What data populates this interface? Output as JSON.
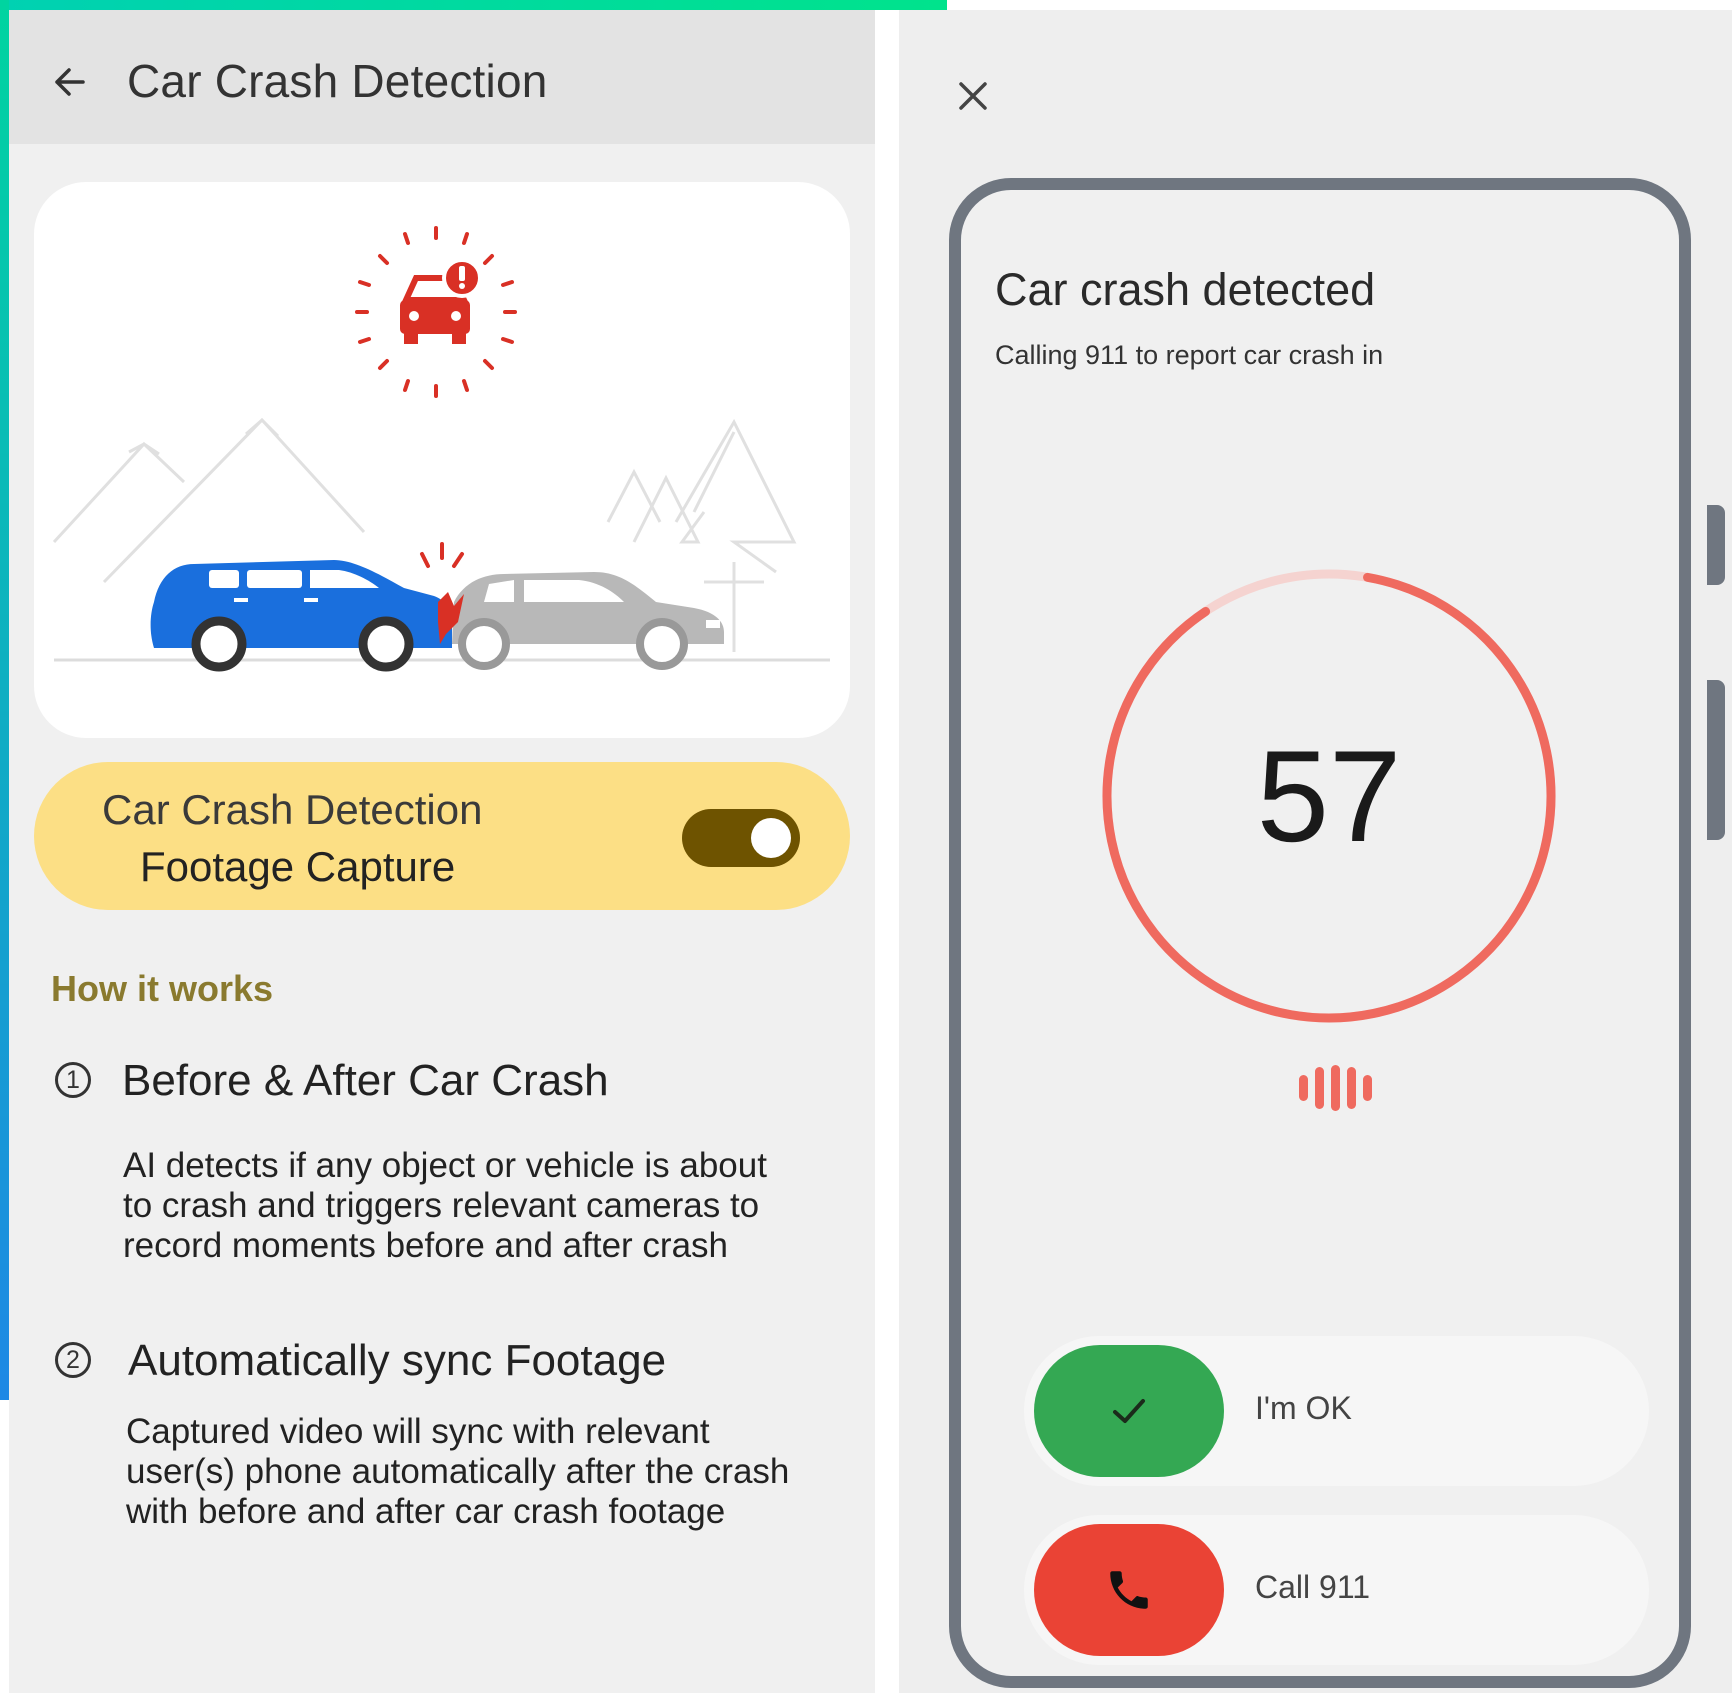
{
  "left": {
    "appbar": {
      "title": "Car Crash Detection",
      "back_icon": "arrow-left-icon"
    },
    "illustration": {
      "icon": "car-crash-alert-icon"
    },
    "toggle_card": {
      "line1": "Car Crash Detection",
      "line2": "Footage Capture",
      "enabled": true
    },
    "how_it_works": {
      "heading": "How it works",
      "steps": [
        {
          "number": "1",
          "title": "Before & After Car Crash",
          "desc_lines": [
            "AI detects if any object or vehicle is about",
            "to crash and triggers relevant cameras to",
            "record moments before and after crash"
          ]
        },
        {
          "number": "2",
          "title": "Automatically sync Footage",
          "desc_lines": [
            "Captured video will sync with relevant",
            "user(s) phone automatically after the crash",
            "with before and after car crash footage"
          ]
        }
      ]
    }
  },
  "right": {
    "close_icon": "close-icon",
    "alert": {
      "title": "Car crash detected",
      "subtitle": "Calling 911 to report car crash in"
    },
    "countdown": {
      "value": "57",
      "ring_color": "#ef6a5f"
    },
    "actions": [
      {
        "label": "I'm OK",
        "icon": "check-icon",
        "color": "#34a853"
      },
      {
        "label": "Call 911",
        "icon": "phone-icon",
        "color": "#ea4335"
      }
    ]
  }
}
